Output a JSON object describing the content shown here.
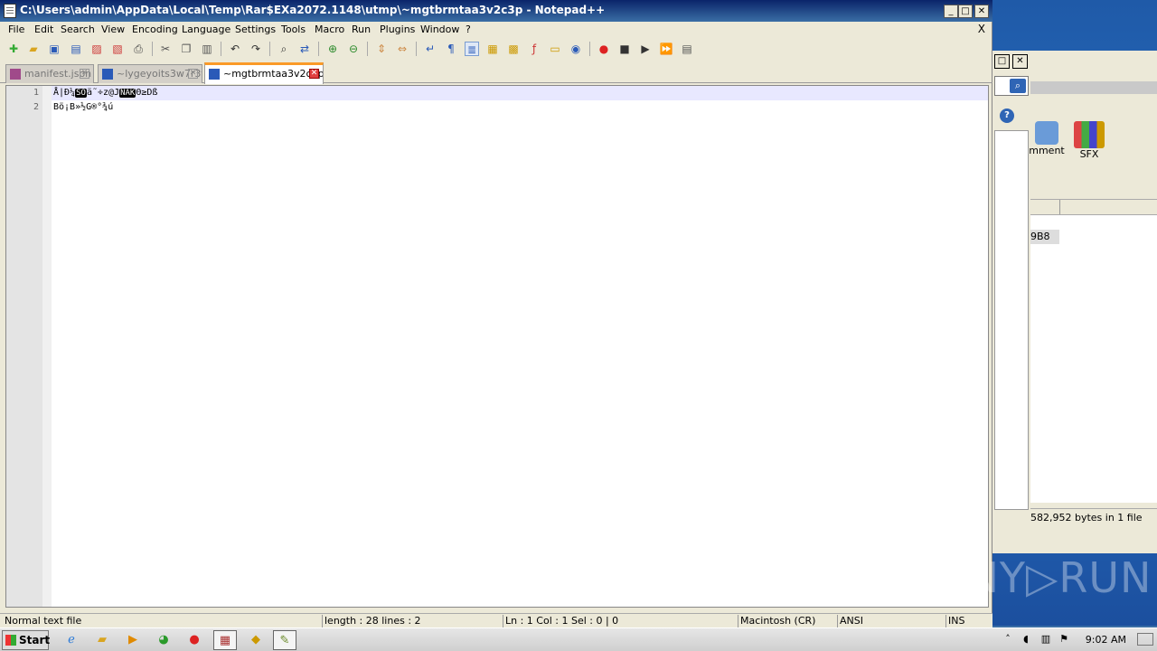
{
  "window": {
    "title": "C:\\Users\\admin\\AppData\\Local\\Temp\\Rar$EXa2072.1148\\utmp\\~mgtbrmtaa3v2c3p - Notepad++"
  },
  "menu": [
    "File",
    "Edit",
    "Search",
    "View",
    "Encoding",
    "Language",
    "Settings",
    "Tools",
    "Macro",
    "Run",
    "Plugins",
    "Window",
    "?"
  ],
  "menu_close": "X",
  "tabs": [
    {
      "label": "manifest.json",
      "active": false
    },
    {
      "label": "~lygeyoits3w7r3f",
      "active": false
    },
    {
      "label": "~mgtbrmtaa3v2c3p",
      "active": true
    }
  ],
  "editor": {
    "line_numbers": [
      "1",
      "2"
    ],
    "lines": [
      {
        "pre": "Å|Ð¼",
        "ctl1": "SO",
        "mid": "ä˜÷z@J",
        "ctl2": "NAK",
        "post": "Θ≥Dß"
      },
      {
        "text": "Bö¡B»½G®°¾ú"
      }
    ]
  },
  "status": {
    "type": "Normal text file",
    "length": "length : 28    lines : 2",
    "position": "Ln : 1    Col : 1    Sel : 0 | 0",
    "eol": "Macintosh (CR)",
    "encoding": "ANSI",
    "mode": "INS"
  },
  "background_window": {
    "toolbar_items": [
      "mment",
      "SFX"
    ],
    "row_value": "9B8",
    "status": "582,952 bytes in 1 file"
  },
  "watermark": "ANY▷RUN",
  "taskbar": {
    "start_label": "Start",
    "clock": "9:02 AM"
  }
}
